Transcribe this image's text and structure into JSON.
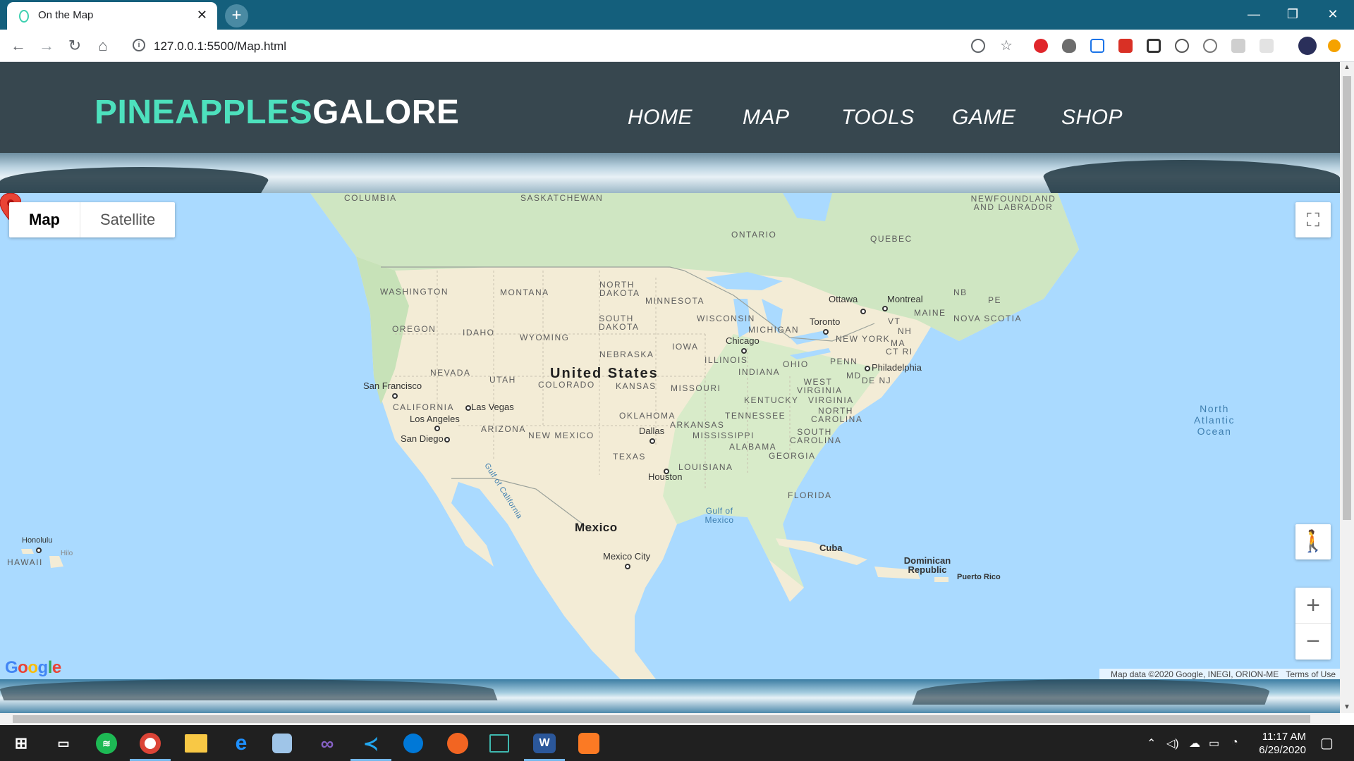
{
  "browser": {
    "tab_title": "On the Map",
    "tab_close": "✕",
    "new_tab": "+",
    "url": "127.0.0.1:5500/Map.html",
    "window_controls": {
      "minimize": "—",
      "maximize": "❐",
      "close": "✕"
    }
  },
  "site": {
    "logo_part1": "PINEAPPLES",
    "logo_part2": "GALORE",
    "nav": [
      "HOME",
      "MAP",
      "TOOLS",
      "GAME",
      "SHOP"
    ],
    "colors": {
      "header_bg": "#37474f",
      "logo_accent": "#4de1bd"
    }
  },
  "map": {
    "type_controls": {
      "active": "Map",
      "inactive": "Satellite"
    },
    "zoom_in": "+",
    "zoom_out": "−",
    "attribution": "Map data ©2020 Google, INEGI, ORION-ME",
    "terms": "Terms of Use",
    "google_logo": "Google",
    "countries": [
      "United States",
      "Mexico"
    ],
    "regions": [
      "COLUMBIA",
      "SASKATCHEWAN",
      "NEWFOUNDLAND AND LABRADOR",
      "ONTARIO",
      "QUEBEC",
      "NORTH DAKOTA",
      "MINNESOTA",
      "WASHINGTON",
      "MONTANA",
      "SOUTH DAKOTA",
      "WISCONSIN",
      "MICHIGAN",
      "OREGON",
      "IDAHO",
      "WYOMING",
      "IOWA",
      "NEBRASKA",
      "NEVADA",
      "UTAH",
      "COLORADO",
      "KANSAS",
      "MISSOURI",
      "ILLINOIS",
      "INDIANA",
      "OHIO",
      "PENN",
      "NEW YORK",
      "CALIFORNIA",
      "OKLAHOMA",
      "ARKANSAS",
      "TENNESSEE",
      "KENTUCKY",
      "WEST VIRGINIA",
      "VIRGINIA",
      "NORTH CAROLINA",
      "SOUTH CAROLINA",
      "ARIZONA",
      "NEW MEXICO",
      "TEXAS",
      "MISSISSIPPI",
      "ALABAMA",
      "GEORGIA",
      "LOUISIANA",
      "FLORIDA",
      "MAINE",
      "NOVA SCOTIA",
      "NB",
      "PE",
      "VT",
      "NH",
      "MA",
      "CT RI",
      "MD",
      "DE NJ",
      "HAWAII"
    ],
    "cities": [
      "Ottawa",
      "Montreal",
      "Toronto",
      "Chicago",
      "Philadelphia",
      "San Francisco",
      "Las Vegas",
      "Los Angeles",
      "San Diego",
      "Dallas",
      "Houston",
      "Mexico City",
      "Cuba",
      "Dominican Republic",
      "Puerto Rico",
      "Honolulu",
      "Hilo"
    ],
    "waters": [
      "North Atlantic Ocean",
      "Gulf of Mexico",
      "Gulf of California"
    ],
    "marker_icon": "map-pin-icon"
  },
  "taskbar": {
    "time": "11:17 AM",
    "date": "6/29/2020"
  }
}
